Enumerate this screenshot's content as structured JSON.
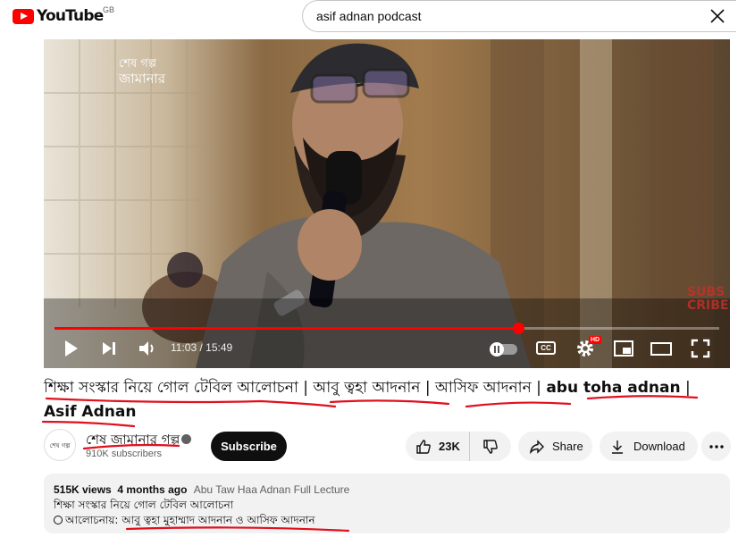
{
  "logo": {
    "text": "YouTube",
    "region": "GB"
  },
  "search": {
    "query": "asif adnan podcast"
  },
  "player": {
    "watermark_line1": "শেষ গল্প",
    "watermark_line2": "জামানার",
    "corner_text_1": "SUBS",
    "corner_text_2": "CRIBE",
    "time_label": "11:03 / 15:49",
    "progress": 0.698,
    "hd_badge": "HD",
    "cc_label": "CC"
  },
  "video": {
    "title_bn_1": "শিক্ষা সংস্কার নিয়ে গোল টেবিল আলোচনা",
    "sep": " | ",
    "title_bn_2": "আবু ত্বহা আদনান",
    "title_bn_3": "আসিফ আদনান",
    "title_en_1": "abu toha adnan",
    "title_en_2": "Asif Adnan"
  },
  "channel": {
    "name": "শেষ জামানার গল্প",
    "subscribers": "910K subscribers",
    "subscribe_label": "Subscribe",
    "avatar_text": "শেষ গল্প"
  },
  "actions": {
    "likes": "23K",
    "share_label": "Share",
    "download_label": "Download"
  },
  "description": {
    "views": "515K views",
    "age": "4 months ago",
    "tag": "Abu Taw Haa Adnan Full Lecture",
    "line1": "শিক্ষা সংস্কার নিয়ে গোল টেবিল আলোচনা",
    "line2_prefix": "আলোচনায়: ",
    "line2_names": "আবু ত্বহা মুহাম্মাদ আদনান ও আসিফ আদনান"
  },
  "colors": {
    "brand": "#ff0000",
    "annotation": "#e0101e"
  }
}
